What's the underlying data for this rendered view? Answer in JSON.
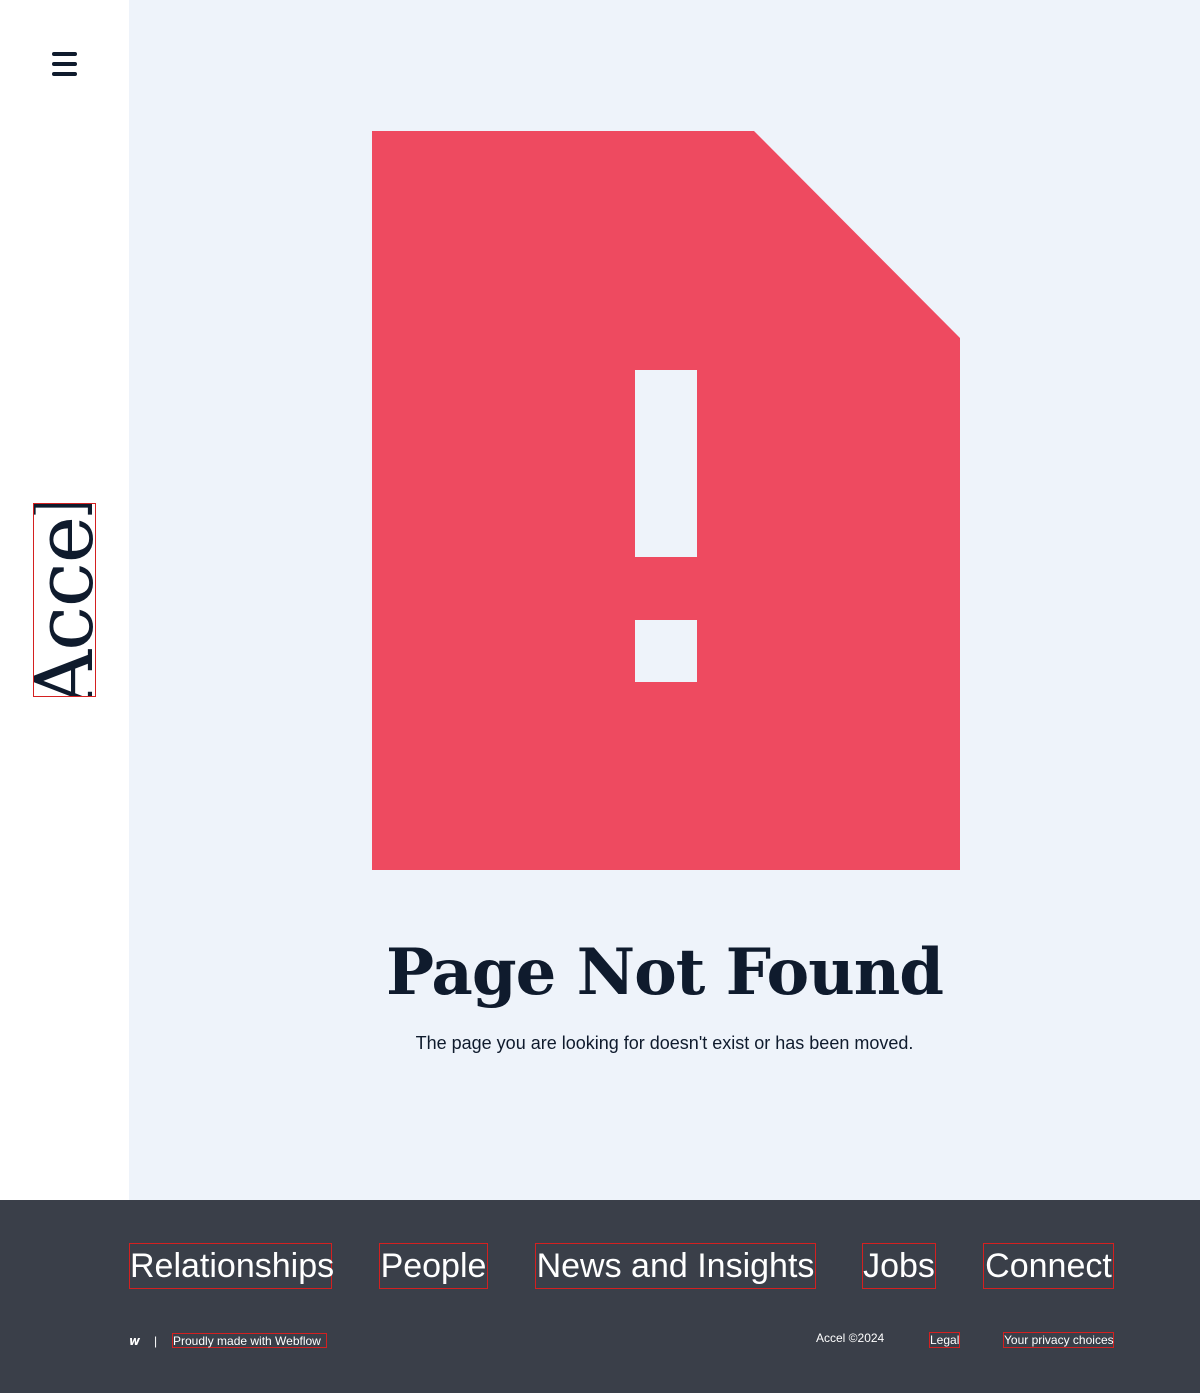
{
  "sidebar": {
    "menu_icon": "hamburger-menu-icon",
    "logo_text": "Accel"
  },
  "main": {
    "error_icon": "file-exclamation-icon",
    "error_color": "#ee4a60",
    "heading": "Page Not Found",
    "message": "The page you are looking for doesn't exist or has been moved."
  },
  "footer": {
    "nav": [
      "Relationships",
      "People",
      "News and Insights",
      "Jobs",
      "Connect"
    ],
    "webflow_icon": "webflow-logo-icon",
    "webflow_mark": "w",
    "separator": "|",
    "made_with": "Proudly made with Webflow",
    "copyright": "Accel ©2024",
    "legal": "Legal",
    "privacy": "Your privacy choices"
  },
  "colors": {
    "sidebar_bg": "#ffffff",
    "main_bg": "#eef3fa",
    "footer_bg": "#3a3f49",
    "text_dark": "#0f1b2d"
  }
}
